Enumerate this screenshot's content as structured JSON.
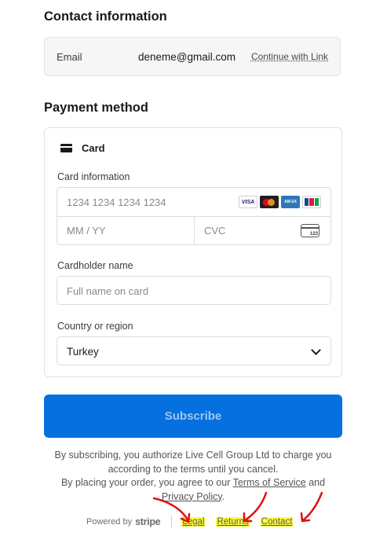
{
  "contact": {
    "title": "Contact information",
    "email_label": "Email",
    "email_value": "deneme@gmail.com",
    "link_label": "Continue with Link"
  },
  "payment": {
    "title": "Payment method",
    "method_label": "Card",
    "card_info_label": "Card information",
    "card_number_placeholder": "1234 1234 1234 1234",
    "expiry_placeholder": "MM / YY",
    "cvc_placeholder": "CVC",
    "cvc_icon_text": "123",
    "card_brands": [
      "VISA",
      "mastercard",
      "amex",
      "jcb"
    ],
    "cardholder_label": "Cardholder name",
    "cardholder_placeholder": "Full name on card",
    "country_label": "Country or region",
    "country_value": "Turkey"
  },
  "subscribe": {
    "label": "Subscribe",
    "bg_color": "#0570de"
  },
  "legal": {
    "line1": "By subscribing, you authorize Live Cell Group Ltd to charge you according to the terms until you cancel.",
    "line2_prefix": "By placing your order, you agree to our",
    "terms_link": "Terms of Service",
    "and": "and",
    "privacy_link": "Privacy Policy",
    "period": "."
  },
  "footer": {
    "powered_by": "Powered by",
    "brand": "stripe",
    "links": [
      "Legal",
      "Returns",
      "Contact"
    ],
    "highlight_color": "#ffff3a",
    "annotation_color": "#e01010"
  }
}
